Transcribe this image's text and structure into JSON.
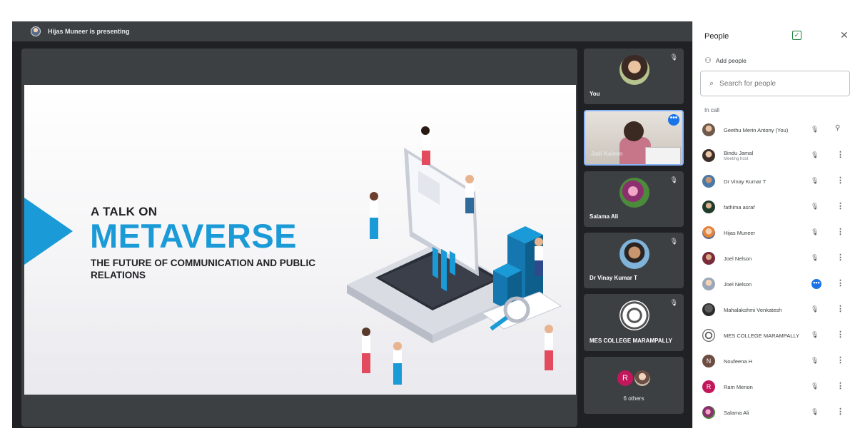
{
  "presenter_bar": {
    "text": "Hijas Muneer is presenting"
  },
  "slide": {
    "line1": "A TALK ON",
    "title": "METAVERSE",
    "subtitle": "THE FUTURE OF COMMUNICATION AND PUBLIC RELATIONS"
  },
  "tiles": [
    {
      "name": "You"
    },
    {
      "name": "Jadi Kaleen"
    },
    {
      "name": "Salama Ali"
    },
    {
      "name": "Dr Vinay Kumar T"
    },
    {
      "name": "MES COLLEGE MARAMPALLY"
    }
  ],
  "others_tile": {
    "avatar_letter": "R",
    "label": "6 others"
  },
  "people_panel": {
    "title": "People",
    "add_people": "Add people",
    "search_placeholder": "Search for people",
    "section_label": "In call",
    "participants": [
      {
        "name": "Geethu Merin Antony (You)",
        "sub": ""
      },
      {
        "name": "Bindu Jamal",
        "sub": "Meeting host"
      },
      {
        "name": "Dr Vinay Kumar T",
        "sub": ""
      },
      {
        "name": "fathima asraf",
        "sub": ""
      },
      {
        "name": "Hijas Muneer",
        "sub": ""
      },
      {
        "name": "Joel Nelson",
        "sub": ""
      },
      {
        "name": "Joel Nelson",
        "sub": ""
      },
      {
        "name": "Mahalakshmi Venkatesh",
        "sub": ""
      },
      {
        "name": "MES COLLEGE MARAMPALLY",
        "sub": ""
      },
      {
        "name": "Noufeena H",
        "sub": "",
        "avatar_letter": "N"
      },
      {
        "name": "Ram Menon",
        "sub": "",
        "avatar_letter": "R"
      },
      {
        "name": "Salama Ali",
        "sub": ""
      }
    ]
  },
  "colors": {
    "accent_blue": "#1a73e8",
    "slide_blue": "#1a9ad6",
    "meet_dark": "#202124",
    "tile_gray": "#3c4043",
    "green_check": "#188038"
  },
  "icons": [
    "presenter-avatar",
    "mic-off-icon",
    "more-icon",
    "check-box-icon",
    "close-icon",
    "add-person-icon",
    "search-icon",
    "pin-icon"
  ]
}
